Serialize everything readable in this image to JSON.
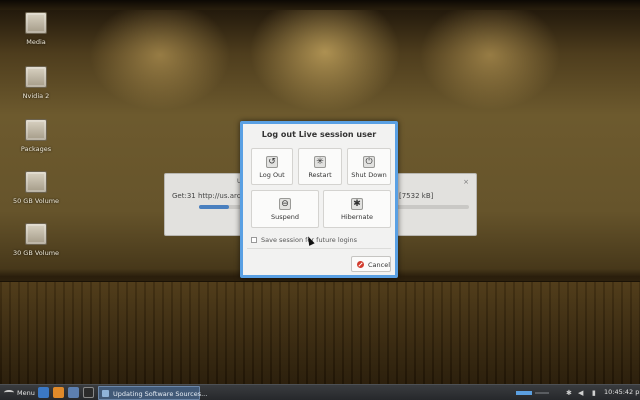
{
  "desktop": {
    "icons": [
      {
        "label": "Media"
      },
      {
        "label": "Nvidia 2"
      },
      {
        "label": "Packages"
      },
      {
        "label": "50 GB Volume"
      },
      {
        "label": "30 GB Volume"
      }
    ]
  },
  "update_window": {
    "title_fragment": "U",
    "status_left": "Get:31 http://us.archive.",
    "status_right": "[7532 kB]",
    "close_glyph": "×",
    "progress_fraction": 0.11
  },
  "logout_dialog": {
    "title": "Log out Live session user",
    "options": [
      {
        "label": "Log Out",
        "icon": "logout-icon",
        "glyph": "↺"
      },
      {
        "label": "Restart",
        "icon": "restart-icon",
        "glyph": "✳"
      },
      {
        "label": "Shut Down",
        "icon": "power-icon",
        "glyph": "⏻"
      },
      {
        "label": "Suspend",
        "icon": "suspend-icon",
        "glyph": "⊖"
      },
      {
        "label": "Hibernate",
        "icon": "hibernate-icon",
        "glyph": "✱"
      }
    ],
    "save_session_label": "Save session for future logins",
    "save_session_checked": false,
    "cancel_label": "Cancel",
    "accent_color": "#5aa0e3"
  },
  "taskbar": {
    "menu_label": "Menu",
    "task_label": "Updating Software Sources...",
    "clock": "10:45:42 pm",
    "tray_bluetooth": "✱",
    "tray_volume": "◀",
    "tray_network": "▮"
  }
}
